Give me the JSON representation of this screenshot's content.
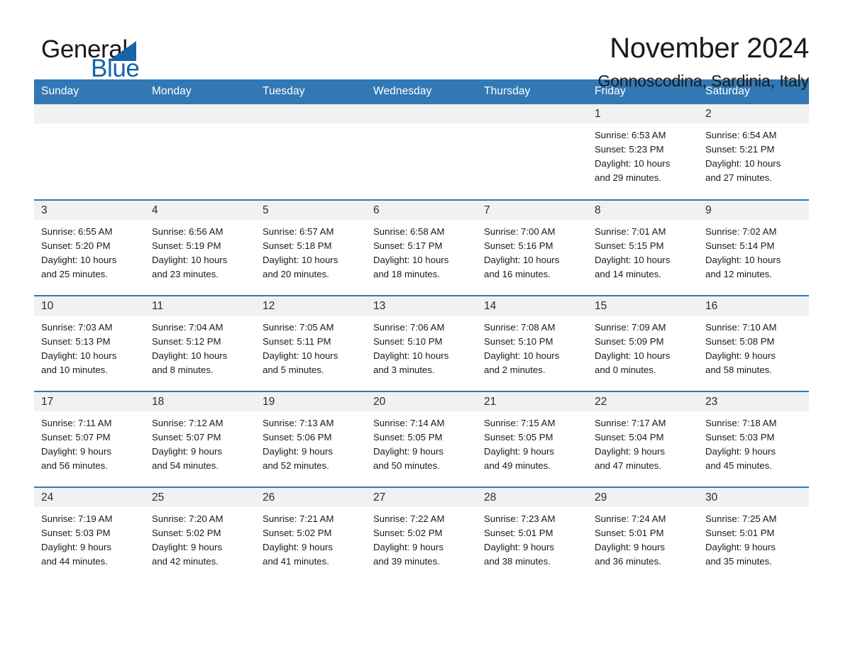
{
  "brand": {
    "name_part1": "General",
    "name_part2": "Blue",
    "accent_color": "#1565a8",
    "triangle_icon": "brand-triangle-icon"
  },
  "header": {
    "title": "November 2024",
    "location": "Gonnoscodina, Sardinia, Italy"
  },
  "calendar": {
    "header_bg": "#3278b5",
    "daynum_bg": "#f1f1f1",
    "weekday_headers": [
      "Sunday",
      "Monday",
      "Tuesday",
      "Wednesday",
      "Thursday",
      "Friday",
      "Saturday"
    ],
    "weeks": [
      [
        {
          "day": "",
          "lines": []
        },
        {
          "day": "",
          "lines": []
        },
        {
          "day": "",
          "lines": []
        },
        {
          "day": "",
          "lines": []
        },
        {
          "day": "",
          "lines": []
        },
        {
          "day": "1",
          "lines": [
            "Sunrise: 6:53 AM",
            "Sunset: 5:23 PM",
            "Daylight: 10 hours",
            "and 29 minutes."
          ]
        },
        {
          "day": "2",
          "lines": [
            "Sunrise: 6:54 AM",
            "Sunset: 5:21 PM",
            "Daylight: 10 hours",
            "and 27 minutes."
          ]
        }
      ],
      [
        {
          "day": "3",
          "lines": [
            "Sunrise: 6:55 AM",
            "Sunset: 5:20 PM",
            "Daylight: 10 hours",
            "and 25 minutes."
          ]
        },
        {
          "day": "4",
          "lines": [
            "Sunrise: 6:56 AM",
            "Sunset: 5:19 PM",
            "Daylight: 10 hours",
            "and 23 minutes."
          ]
        },
        {
          "day": "5",
          "lines": [
            "Sunrise: 6:57 AM",
            "Sunset: 5:18 PM",
            "Daylight: 10 hours",
            "and 20 minutes."
          ]
        },
        {
          "day": "6",
          "lines": [
            "Sunrise: 6:58 AM",
            "Sunset: 5:17 PM",
            "Daylight: 10 hours",
            "and 18 minutes."
          ]
        },
        {
          "day": "7",
          "lines": [
            "Sunrise: 7:00 AM",
            "Sunset: 5:16 PM",
            "Daylight: 10 hours",
            "and 16 minutes."
          ]
        },
        {
          "day": "8",
          "lines": [
            "Sunrise: 7:01 AM",
            "Sunset: 5:15 PM",
            "Daylight: 10 hours",
            "and 14 minutes."
          ]
        },
        {
          "day": "9",
          "lines": [
            "Sunrise: 7:02 AM",
            "Sunset: 5:14 PM",
            "Daylight: 10 hours",
            "and 12 minutes."
          ]
        }
      ],
      [
        {
          "day": "10",
          "lines": [
            "Sunrise: 7:03 AM",
            "Sunset: 5:13 PM",
            "Daylight: 10 hours",
            "and 10 minutes."
          ]
        },
        {
          "day": "11",
          "lines": [
            "Sunrise: 7:04 AM",
            "Sunset: 5:12 PM",
            "Daylight: 10 hours",
            "and 8 minutes."
          ]
        },
        {
          "day": "12",
          "lines": [
            "Sunrise: 7:05 AM",
            "Sunset: 5:11 PM",
            "Daylight: 10 hours",
            "and 5 minutes."
          ]
        },
        {
          "day": "13",
          "lines": [
            "Sunrise: 7:06 AM",
            "Sunset: 5:10 PM",
            "Daylight: 10 hours",
            "and 3 minutes."
          ]
        },
        {
          "day": "14",
          "lines": [
            "Sunrise: 7:08 AM",
            "Sunset: 5:10 PM",
            "Daylight: 10 hours",
            "and 2 minutes."
          ]
        },
        {
          "day": "15",
          "lines": [
            "Sunrise: 7:09 AM",
            "Sunset: 5:09 PM",
            "Daylight: 10 hours",
            "and 0 minutes."
          ]
        },
        {
          "day": "16",
          "lines": [
            "Sunrise: 7:10 AM",
            "Sunset: 5:08 PM",
            "Daylight: 9 hours",
            "and 58 minutes."
          ]
        }
      ],
      [
        {
          "day": "17",
          "lines": [
            "Sunrise: 7:11 AM",
            "Sunset: 5:07 PM",
            "Daylight: 9 hours",
            "and 56 minutes."
          ]
        },
        {
          "day": "18",
          "lines": [
            "Sunrise: 7:12 AM",
            "Sunset: 5:07 PM",
            "Daylight: 9 hours",
            "and 54 minutes."
          ]
        },
        {
          "day": "19",
          "lines": [
            "Sunrise: 7:13 AM",
            "Sunset: 5:06 PM",
            "Daylight: 9 hours",
            "and 52 minutes."
          ]
        },
        {
          "day": "20",
          "lines": [
            "Sunrise: 7:14 AM",
            "Sunset: 5:05 PM",
            "Daylight: 9 hours",
            "and 50 minutes."
          ]
        },
        {
          "day": "21",
          "lines": [
            "Sunrise: 7:15 AM",
            "Sunset: 5:05 PM",
            "Daylight: 9 hours",
            "and 49 minutes."
          ]
        },
        {
          "day": "22",
          "lines": [
            "Sunrise: 7:17 AM",
            "Sunset: 5:04 PM",
            "Daylight: 9 hours",
            "and 47 minutes."
          ]
        },
        {
          "day": "23",
          "lines": [
            "Sunrise: 7:18 AM",
            "Sunset: 5:03 PM",
            "Daylight: 9 hours",
            "and 45 minutes."
          ]
        }
      ],
      [
        {
          "day": "24",
          "lines": [
            "Sunrise: 7:19 AM",
            "Sunset: 5:03 PM",
            "Daylight: 9 hours",
            "and 44 minutes."
          ]
        },
        {
          "day": "25",
          "lines": [
            "Sunrise: 7:20 AM",
            "Sunset: 5:02 PM",
            "Daylight: 9 hours",
            "and 42 minutes."
          ]
        },
        {
          "day": "26",
          "lines": [
            "Sunrise: 7:21 AM",
            "Sunset: 5:02 PM",
            "Daylight: 9 hours",
            "and 41 minutes."
          ]
        },
        {
          "day": "27",
          "lines": [
            "Sunrise: 7:22 AM",
            "Sunset: 5:02 PM",
            "Daylight: 9 hours",
            "and 39 minutes."
          ]
        },
        {
          "day": "28",
          "lines": [
            "Sunrise: 7:23 AM",
            "Sunset: 5:01 PM",
            "Daylight: 9 hours",
            "and 38 minutes."
          ]
        },
        {
          "day": "29",
          "lines": [
            "Sunrise: 7:24 AM",
            "Sunset: 5:01 PM",
            "Daylight: 9 hours",
            "and 36 minutes."
          ]
        },
        {
          "day": "30",
          "lines": [
            "Sunrise: 7:25 AM",
            "Sunset: 5:01 PM",
            "Daylight: 9 hours",
            "and 35 minutes."
          ]
        }
      ]
    ]
  }
}
